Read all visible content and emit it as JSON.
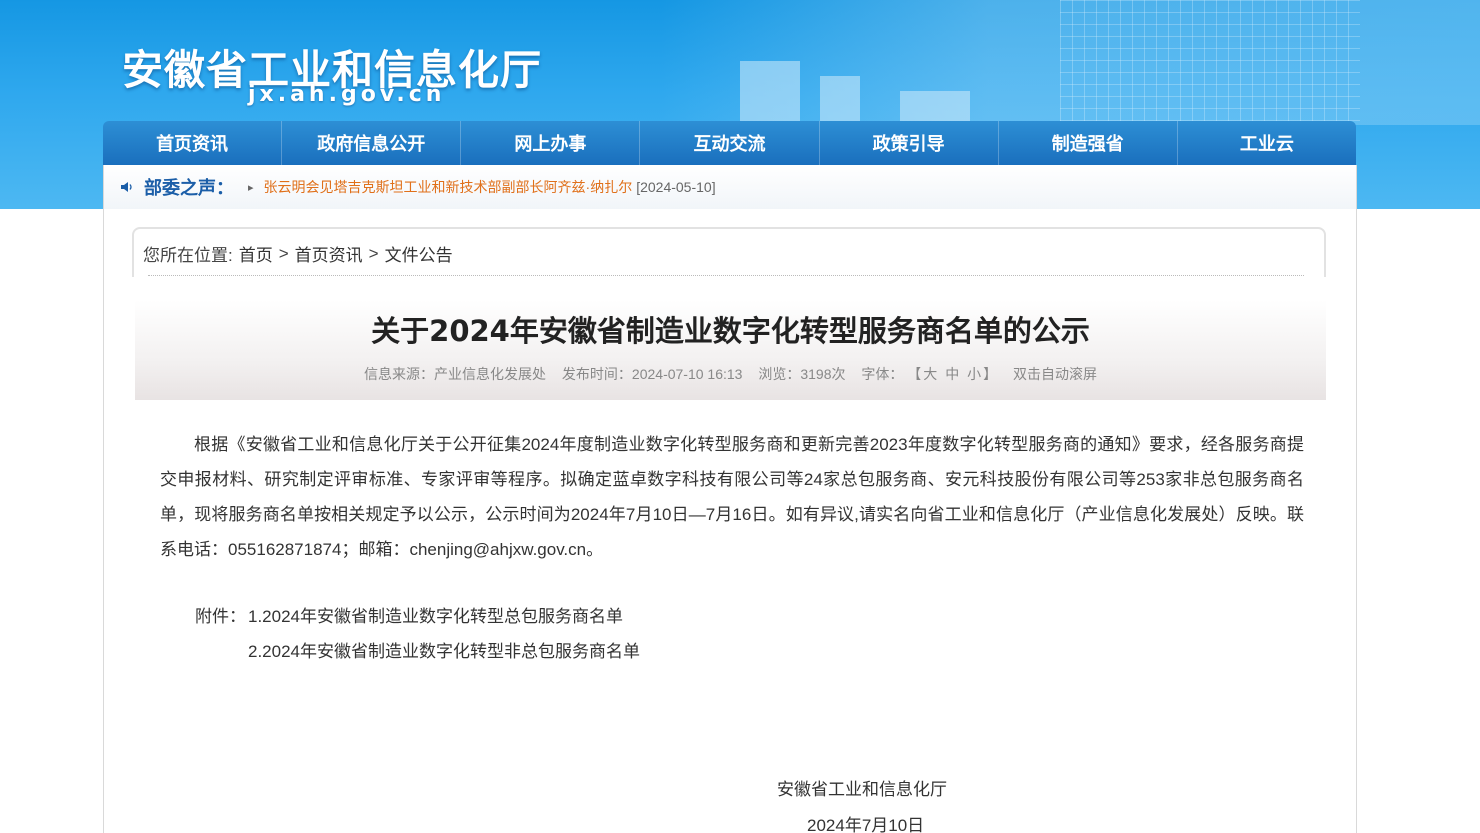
{
  "header": {
    "site_title": "安徽省工业和信息化厅",
    "site_domain": "jx.ah.gov.cn"
  },
  "nav": {
    "items": [
      {
        "label": "首页资讯"
      },
      {
        "label": "政府信息公开"
      },
      {
        "label": "网上办事"
      },
      {
        "label": "互动交流"
      },
      {
        "label": "政策引导"
      },
      {
        "label": "制造强省"
      },
      {
        "label": "工业云"
      }
    ]
  },
  "ticker": {
    "label": "部委之声：",
    "headline": "张云明会见塔吉克斯坦工业和新技术部副部长阿齐兹·纳扎尔",
    "date": "[2024-05-10]"
  },
  "breadcrumb": {
    "prefix": "您所在位置:",
    "items": [
      "首页",
      "首页资讯",
      "文件公告"
    ],
    "separator": ">"
  },
  "article": {
    "title": "关于2024年安徽省制造业数字化转型服务商名单的公示",
    "meta": {
      "source": "信息来源：产业信息化发展处",
      "published": "发布时间：2024-07-10 16:13",
      "views": "浏览：3198次",
      "font_label": "字体：",
      "font_open": "【",
      "font_large": "大",
      "font_medium": "中",
      "font_small": "小",
      "font_close": "】",
      "autoscroll": "双击自动滚屏"
    },
    "body": "根据《安徽省工业和信息化厅关于公开征集2024年度制造业数字化转型服务商和更新完善2023年度数字化转型服务商的通知》要求，经各服务商提交申报材料、研究制定评审标准、专家评审等程序。拟确定蓝卓数字科技有限公司等24家总包服务商、安元科技股份有限公司等253家非总包服务商名单，现将服务商名单按相关规定予以公示，公示时间为2024年7月10日—7月16日。如有异议,请实名向省工业和信息化厅（产业信息化发展处）反映。联系电话：055162871874；邮箱：chenjing@ahjxw.gov.cn。",
    "attachments_label": "附件：",
    "attachments": [
      "1.2024年安徽省制造业数字化转型总包服务商名单",
      "2.2024年安徽省制造业数字化转型非总包服务商名单"
    ],
    "signature_org": "安徽省工业和信息化厅",
    "signature_date": "2024年7月10日"
  },
  "colors": {
    "banner": "#1597e3",
    "nav": "#1a6fbd",
    "ticker_label": "#1b5ea8",
    "ticker_link": "#e0701a"
  },
  "icons": {
    "speaker": "speaker-icon",
    "chevron": "chevron-right-icon"
  }
}
